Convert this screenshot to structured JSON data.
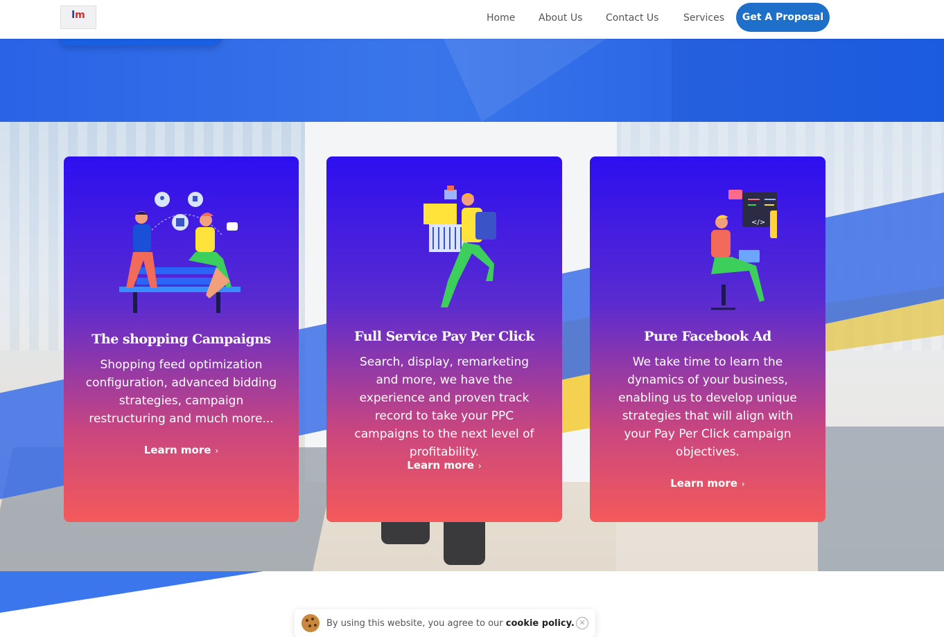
{
  "header": {
    "nav": [
      "Home",
      "About Us",
      "Contact Us",
      "Services"
    ],
    "cta": "Get A Proposal"
  },
  "cards": [
    {
      "title": "The shopping Campaigns",
      "text": "Shopping feed optimization configuration, advanced bidding strategies, campaign restructuring and much more...",
      "link": "Learn more",
      "icon": "people-on-bench-illustration"
    },
    {
      "title": "Full Service Pay Per Click",
      "text": "Search, display, remarketing and more, we have the experience and proven track record to take your PPC campaigns to the next level of profitability.",
      "link": "Learn more",
      "icon": "delivery-person-illustration"
    },
    {
      "title": "Pure Facebook Ad",
      "text": "We take time to learn the dynamics of your business, enabling us to develop unique strategies that will align with your Pay Per Click campaign objectives.",
      "link": "Learn more",
      "icon": "developer-at-desk-illustration"
    }
  ],
  "cookie": {
    "text": "By using this website, you agree to our ",
    "link": "cookie policy."
  },
  "colors": {
    "accent": "#1e6fc9",
    "band": "#2a63e6",
    "card_top": "#2d0ff0",
    "card_bottom": "#f45a5a"
  }
}
